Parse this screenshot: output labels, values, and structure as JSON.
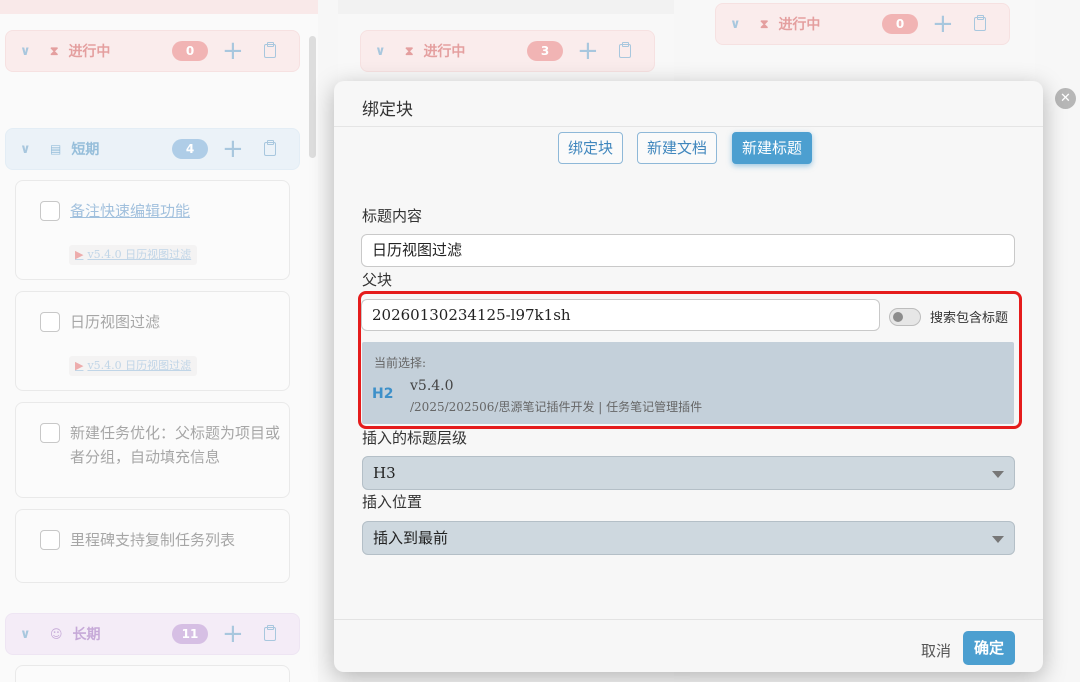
{
  "background": {
    "columns": [
      {
        "groups": [
          {
            "name": "进行中",
            "count": "0",
            "icon": "hourglass-icon"
          },
          {
            "name": "短期",
            "count": "4",
            "icon": "notepad-icon"
          },
          {
            "name": "长期",
            "count": "11",
            "icon": "smile-icon"
          }
        ],
        "cards": [
          {
            "text": "备注快速编辑功能",
            "tag": "v5.4.0 日历视图过滤"
          },
          {
            "text": "日历视图过滤",
            "tag": "v5.4.0 日历视图过滤"
          },
          {
            "text": "新建任务优化：父标题为项目或者分组，自动填充信息"
          },
          {
            "text": "里程碑支持复制任务列表"
          }
        ]
      },
      {
        "groups": [
          {
            "name": "进行中",
            "count": "3",
            "icon": "hourglass-icon"
          }
        ]
      },
      {
        "groups": [
          {
            "name": "进行中",
            "count": "0",
            "icon": "hourglass-icon"
          }
        ]
      }
    ]
  },
  "dialog": {
    "title": "绑定块",
    "tabs": [
      {
        "label": "绑定块",
        "active": false
      },
      {
        "label": "新建文档",
        "active": false
      },
      {
        "label": "新建标题",
        "active": true
      }
    ],
    "heading_label": "标题内容",
    "heading_value": "日历视图过滤",
    "parent_label": "父块",
    "parent_value": "20260130234125-l97k1sh",
    "search_toggle_label": "搜索包含标题",
    "current_selection_caption": "当前选择:",
    "current_selection_level": "H2",
    "current_selection_name": "v5.4.0",
    "current_selection_path": "/2025/202506/思源笔记插件开发 | 任务笔记管理插件",
    "level_label": "插入的标题层级",
    "level_value": "H3",
    "position_label": "插入位置",
    "position_value": "插入到最前",
    "cancel_label": "取消",
    "confirm_label": "确定"
  },
  "colors": {
    "accent": "#4c9fd0",
    "highlight_box": "#e51c1c",
    "in_progress": "#e77f7f",
    "short_term": "#75a9d6",
    "long_term": "#b892d1"
  }
}
